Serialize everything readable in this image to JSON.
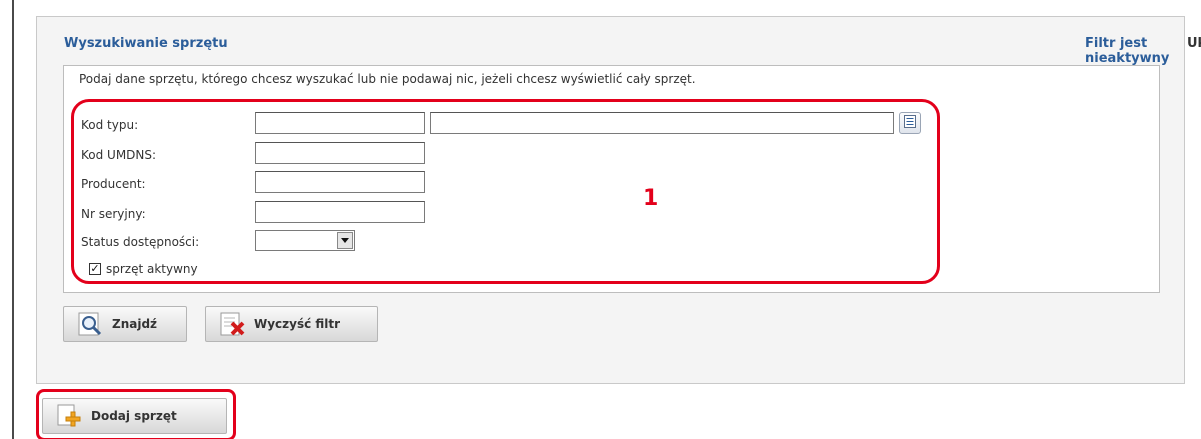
{
  "panel": {
    "title": "Wyszukiwanie sprzętu",
    "filter_status": "Filtr jest nieaktywny",
    "hide_label": "Ukryj"
  },
  "filter": {
    "description": "Podaj dane sprzętu, którego chcesz wyszukać lub nie podawaj nic, jeżeli chcesz wyświetlić cały sprzęt.",
    "fields": {
      "type_code_label": "Kod typu:",
      "umdns_label": "Kod UMDNS:",
      "manufacturer_label": "Producent:",
      "serial_label": "Nr seryjny:",
      "availability_label": "Status dostępności:",
      "type_code_value": "",
      "type_name_value": "",
      "umdns_value": "",
      "manufacturer_value": "",
      "serial_value": "",
      "availability_value": ""
    },
    "active_checkbox_label": "sprzęt aktywny",
    "active_checked": true,
    "highlight_number": "1"
  },
  "actions": {
    "find_label": "Znajdź",
    "clear_label": "Wyczyść filtr",
    "add_label": "Dodaj sprzęt"
  },
  "colors": {
    "link_blue": "#2b5d9a",
    "highlight_red": "#e3001b",
    "panel_bg": "#f4f4f4"
  },
  "icons": {
    "find": "magnifier-icon",
    "clear": "clear-filter-icon",
    "add": "add-icon",
    "list": "list-picker-icon",
    "dropdown": "chevron-down-icon"
  }
}
